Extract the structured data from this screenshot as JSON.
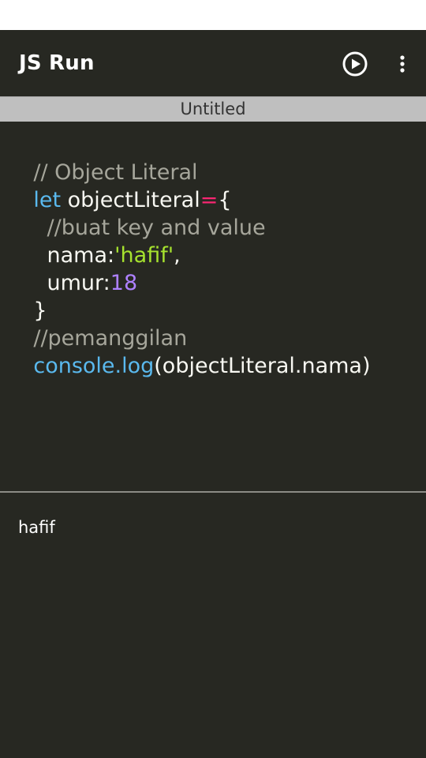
{
  "app": {
    "title": "JS Run",
    "run_icon": "play-circle-icon",
    "menu_icon": "more-vert-icon"
  },
  "file": {
    "name": "Untitled"
  },
  "editor": {
    "lines": [
      [
        {
          "t": "// Object Literal",
          "k": "comment"
        }
      ],
      [
        {
          "t": "let",
          "k": "keyword"
        },
        {
          "t": " objectLiteral",
          "k": "plain"
        },
        {
          "t": "=",
          "k": "op"
        },
        {
          "t": "{",
          "k": "plain"
        }
      ],
      [
        {
          "t": "  //buat key and value",
          "k": "comment"
        }
      ],
      [
        {
          "t": "  nama:",
          "k": "plain"
        },
        {
          "t": "'hafif'",
          "k": "string"
        },
        {
          "t": ",",
          "k": "plain"
        }
      ],
      [
        {
          "t": "  umur:",
          "k": "plain"
        },
        {
          "t": "18",
          "k": "number"
        }
      ],
      [
        {
          "t": "}",
          "k": "plain"
        }
      ],
      [
        {
          "t": "//pemanggilan",
          "k": "comment"
        }
      ],
      [
        {
          "t": "console.log",
          "k": "func"
        },
        {
          "t": "(objectLiteral.nama)",
          "k": "plain"
        }
      ]
    ]
  },
  "console": {
    "output": "hafif"
  },
  "colors": {
    "background": "#272822",
    "comment": "#a6a69b",
    "keyword": "#5ab9ee",
    "operator": "#f92672",
    "string": "#a6e22e",
    "number": "#ae81ff"
  }
}
